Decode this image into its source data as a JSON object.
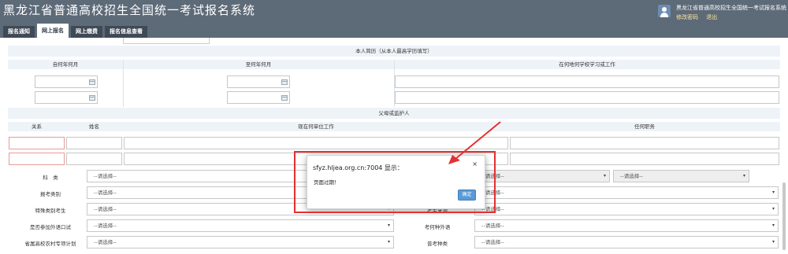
{
  "header": {
    "title": "黑龙江省普通高校招生全国统一考试报名系统",
    "tabs": [
      {
        "label": "报名通知",
        "active": false
      },
      {
        "label": "网上报名",
        "active": true
      },
      {
        "label": "网上缴费",
        "active": false
      },
      {
        "label": "报名信息查看",
        "active": false
      }
    ],
    "user": {
      "name": "黑龙江省普通高校招生全国统一考试报名系统",
      "change_password": "修改密码",
      "logout": "退出"
    }
  },
  "resume": {
    "title": "本人简历（从本人最高学历填写）",
    "col_from": "自何年何月",
    "col_to": "至何年何月",
    "col_where": "在何地何学校学习或工作"
  },
  "guardian": {
    "title": "父母或监护人",
    "col_relation": "关系",
    "col_name": "姓名",
    "col_work": "现在何单位工作",
    "col_duty": "任何职务"
  },
  "form": {
    "select_placeholder": "--请选择--",
    "subject_label": "科　类",
    "exam_type_label": "报考类别",
    "special_type_label": "特殊类别考生",
    "oral_test_label": "是否参加外语口试",
    "rural_plan_label": "省属高校农村专项计划",
    "candidate_source_label": "考生来源",
    "foreign_language_label": "考何种外语",
    "graduation_type_label": "普考种类"
  },
  "dialog": {
    "title": "sfyz.hljea.org.cn:7004 显示：",
    "message": "页面过期！",
    "ok": "确定",
    "close": "×"
  },
  "colors": {
    "header_bg": "#5d6a78",
    "highlight": "#e53030",
    "ok_button": "#5b9bd5"
  }
}
